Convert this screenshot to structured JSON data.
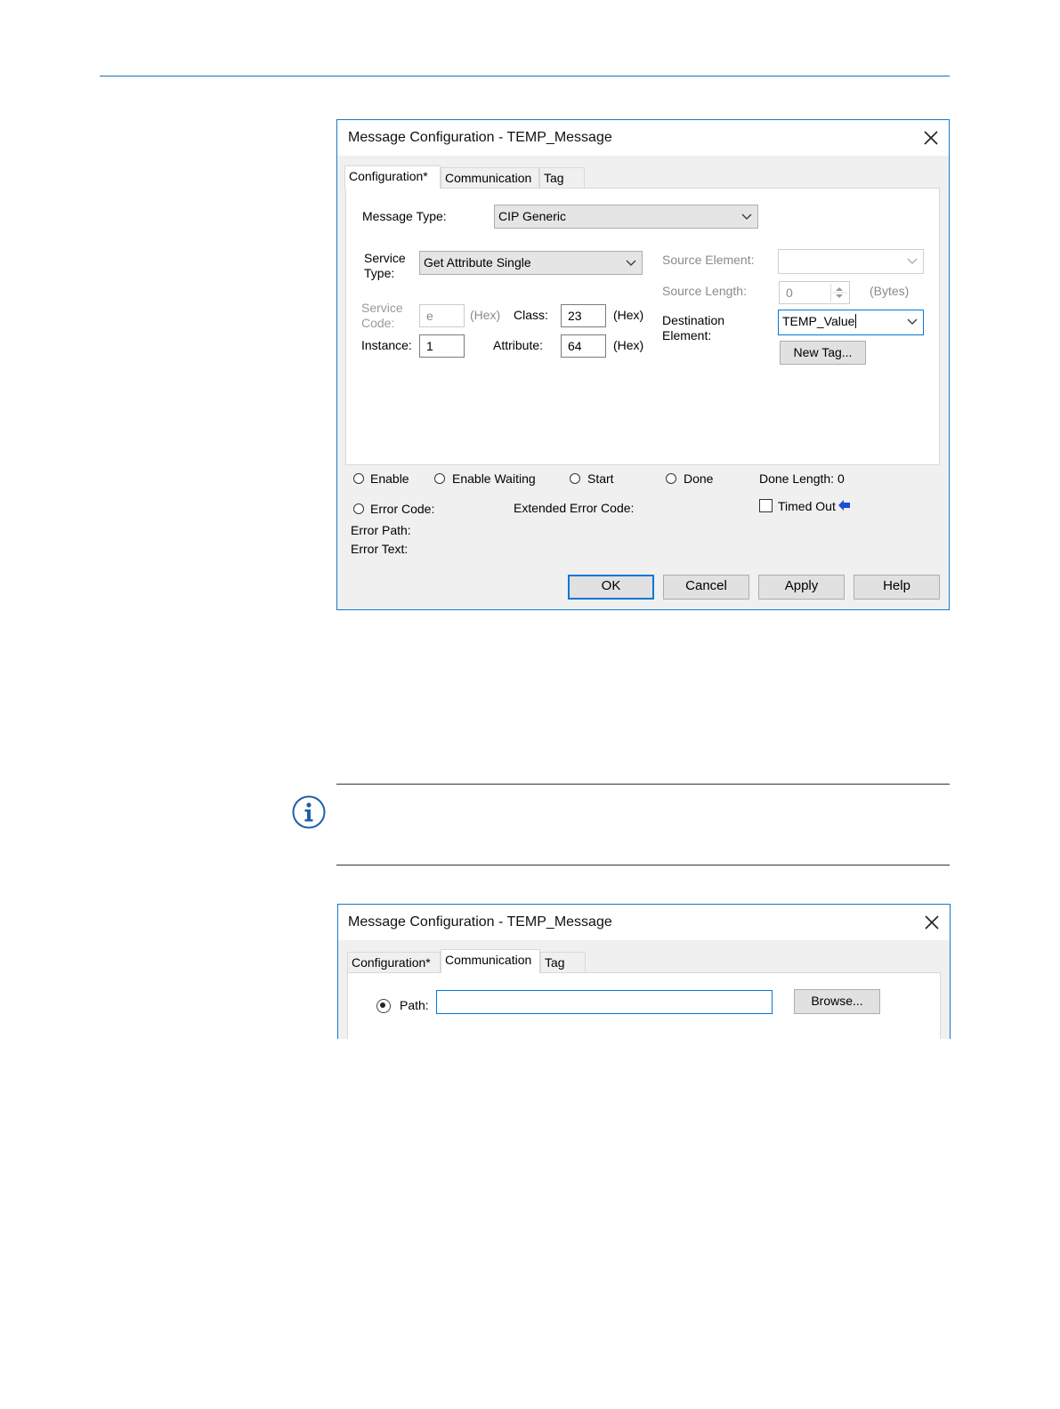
{
  "dialog1": {
    "title": "Message Configuration - TEMP_Message",
    "tabs": [
      {
        "label": "Configuration*"
      },
      {
        "label": "Communication"
      },
      {
        "label": "Tag"
      }
    ],
    "message_type": {
      "label": "Message Type:",
      "value": "CIP Generic"
    },
    "service_type": {
      "label_line1": "Service",
      "label_line2": "Type:",
      "value": "Get Attribute Single"
    },
    "service_code": {
      "label_line1": "Service",
      "label_line2": "Code:",
      "value": "e",
      "unit": "(Hex)"
    },
    "class": {
      "label": "Class:",
      "value": "23",
      "unit": "(Hex)"
    },
    "instance": {
      "label": "Instance:",
      "value": "1"
    },
    "attribute": {
      "label": "Attribute:",
      "value": "64",
      "unit": "(Hex)"
    },
    "source_element": {
      "label": "Source Element:",
      "value": ""
    },
    "source_length": {
      "label": "Source Length:",
      "value": "0",
      "unit": "(Bytes)"
    },
    "destination_element": {
      "label_line1": "Destination",
      "label_line2": "Element:",
      "value": "TEMP_Value"
    },
    "new_tag_label": "New Tag...",
    "status": {
      "enable": "Enable",
      "enable_waiting": "Enable Waiting",
      "start": "Start",
      "done": "Done",
      "done_length": "Done Length:  0",
      "error_code": "Error Code:",
      "extended_error_code": "Extended Error Code:",
      "timed_out": "Timed Out",
      "error_path": "Error Path:",
      "error_text": "Error Text:"
    },
    "buttons": {
      "ok": "OK",
      "cancel": "Cancel",
      "apply": "Apply",
      "help": "Help"
    },
    "colors": {
      "accent": "#0078d7",
      "arrow": "#1a4fd6"
    }
  },
  "dialog2": {
    "title": "Message Configuration - TEMP_Message",
    "tabs": [
      {
        "label": "Configuration*"
      },
      {
        "label": "Communication"
      },
      {
        "label": "Tag"
      }
    ],
    "path_label": "Path:",
    "path_value": "",
    "browse_label": "Browse..."
  },
  "icons": {
    "note": "info-icon",
    "close": "close-icon",
    "arrow": "arrow-left-icon"
  }
}
